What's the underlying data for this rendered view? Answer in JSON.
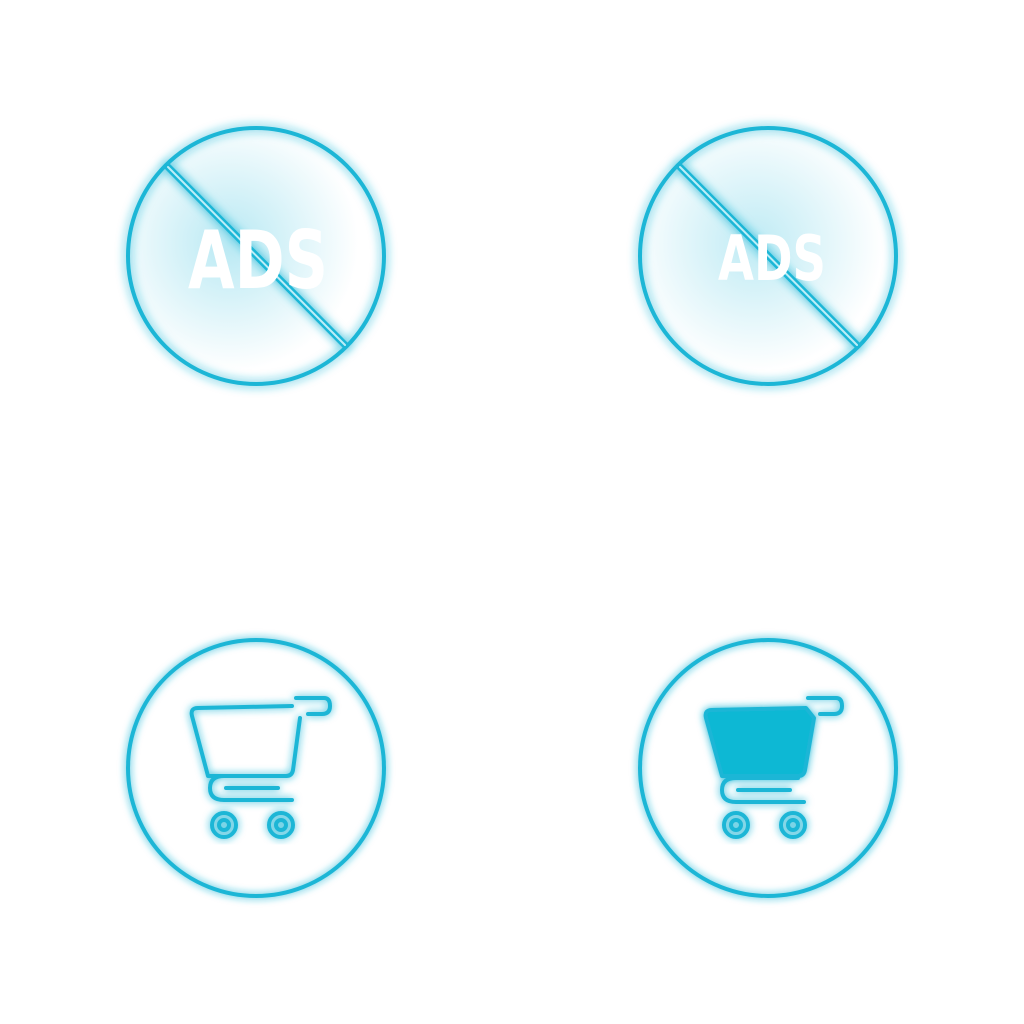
{
  "colors": {
    "neon": "#1fb6d6",
    "neon_fill": "#0bb8d4",
    "glow": "#7fd7ea",
    "text": "#ffffff",
    "background": "#ffffff"
  },
  "icons": [
    {
      "name": "no-ads-icon",
      "label": "ADS",
      "style": "outline"
    },
    {
      "name": "no-ads-icon",
      "label": "ADS",
      "style": "outline-small-text"
    },
    {
      "name": "shopping-cart-icon",
      "style": "outline"
    },
    {
      "name": "shopping-cart-icon",
      "style": "filled"
    }
  ]
}
